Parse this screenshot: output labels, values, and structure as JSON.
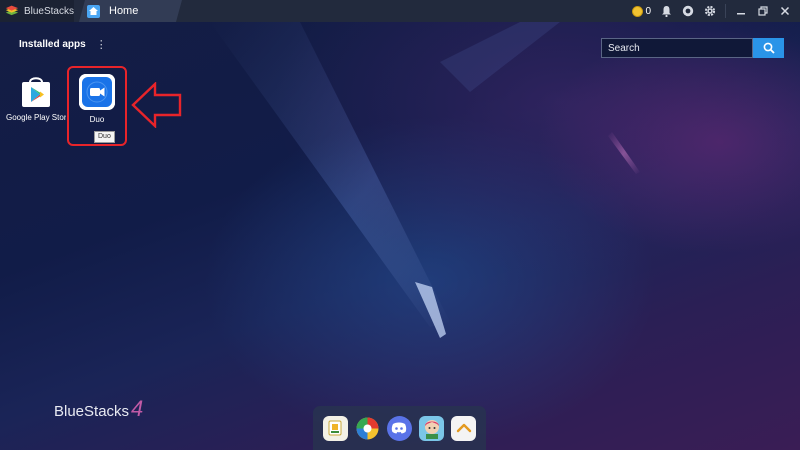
{
  "titlebar": {
    "app_name": "BlueStacks",
    "tab_home_label": "Home",
    "coin_count": "0",
    "icons": [
      "bluestacks-logo-icon",
      "home-icon",
      "coin-icon",
      "bell-icon",
      "record-icon",
      "gear-icon",
      "minimize-icon",
      "restore-icon",
      "close-icon"
    ]
  },
  "desktop": {
    "installed_apps_title": "Installed apps",
    "menu_glyph": "⋮",
    "search": {
      "placeholder": "Search"
    },
    "apps": [
      {
        "label": "Google Play Store",
        "icon": "google-play-icon"
      },
      {
        "label": "Duo",
        "icon": "duo-video-icon",
        "tooltip": "Duo"
      }
    ],
    "watermark": {
      "word": "BlueStacks",
      "number": "4"
    }
  },
  "dock": {
    "items": [
      {
        "icon": "app-center-icon"
      },
      {
        "icon": "game-pop-icon"
      },
      {
        "icon": "discord-icon"
      },
      {
        "icon": "game-character-icon"
      },
      {
        "icon": "chevron-up-icon"
      }
    ]
  },
  "colors": {
    "accent_blue": "#2a94e8",
    "highlight_red": "#e8242a",
    "titlebar_bg": "#222a3d"
  }
}
